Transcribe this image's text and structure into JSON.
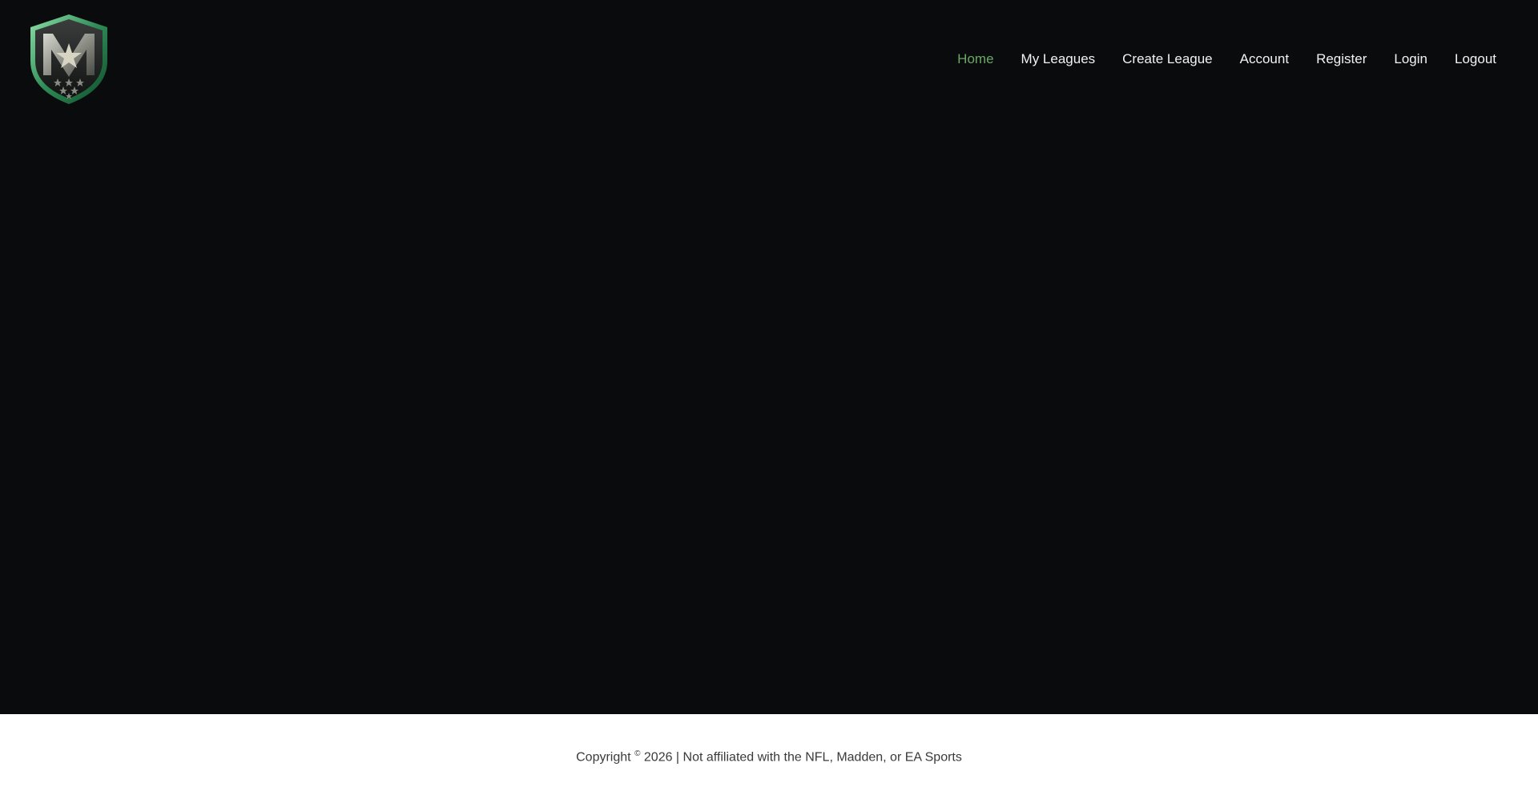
{
  "logo": {
    "icon": "shield-m-star-logo",
    "letter": "M",
    "brand_green": "#2e8b57"
  },
  "nav": {
    "items": [
      {
        "label": "Home",
        "active": true
      },
      {
        "label": "My Leagues",
        "active": false
      },
      {
        "label": "Create League",
        "active": false
      },
      {
        "label": "Account",
        "active": false
      },
      {
        "label": "Register",
        "active": false
      },
      {
        "label": "Login",
        "active": false
      },
      {
        "label": "Logout",
        "active": false
      }
    ],
    "active_color": "#6aa865",
    "text_color": "#f2f2f2"
  },
  "footer": {
    "copyright_prefix": "Copyright",
    "copyright_symbol": "©",
    "copyright_rest": "2026 | Not affiliated with the NFL, Madden, or EA Sports"
  },
  "theme": {
    "background": "#0a0b0d",
    "footer_background": "#ffffff"
  }
}
